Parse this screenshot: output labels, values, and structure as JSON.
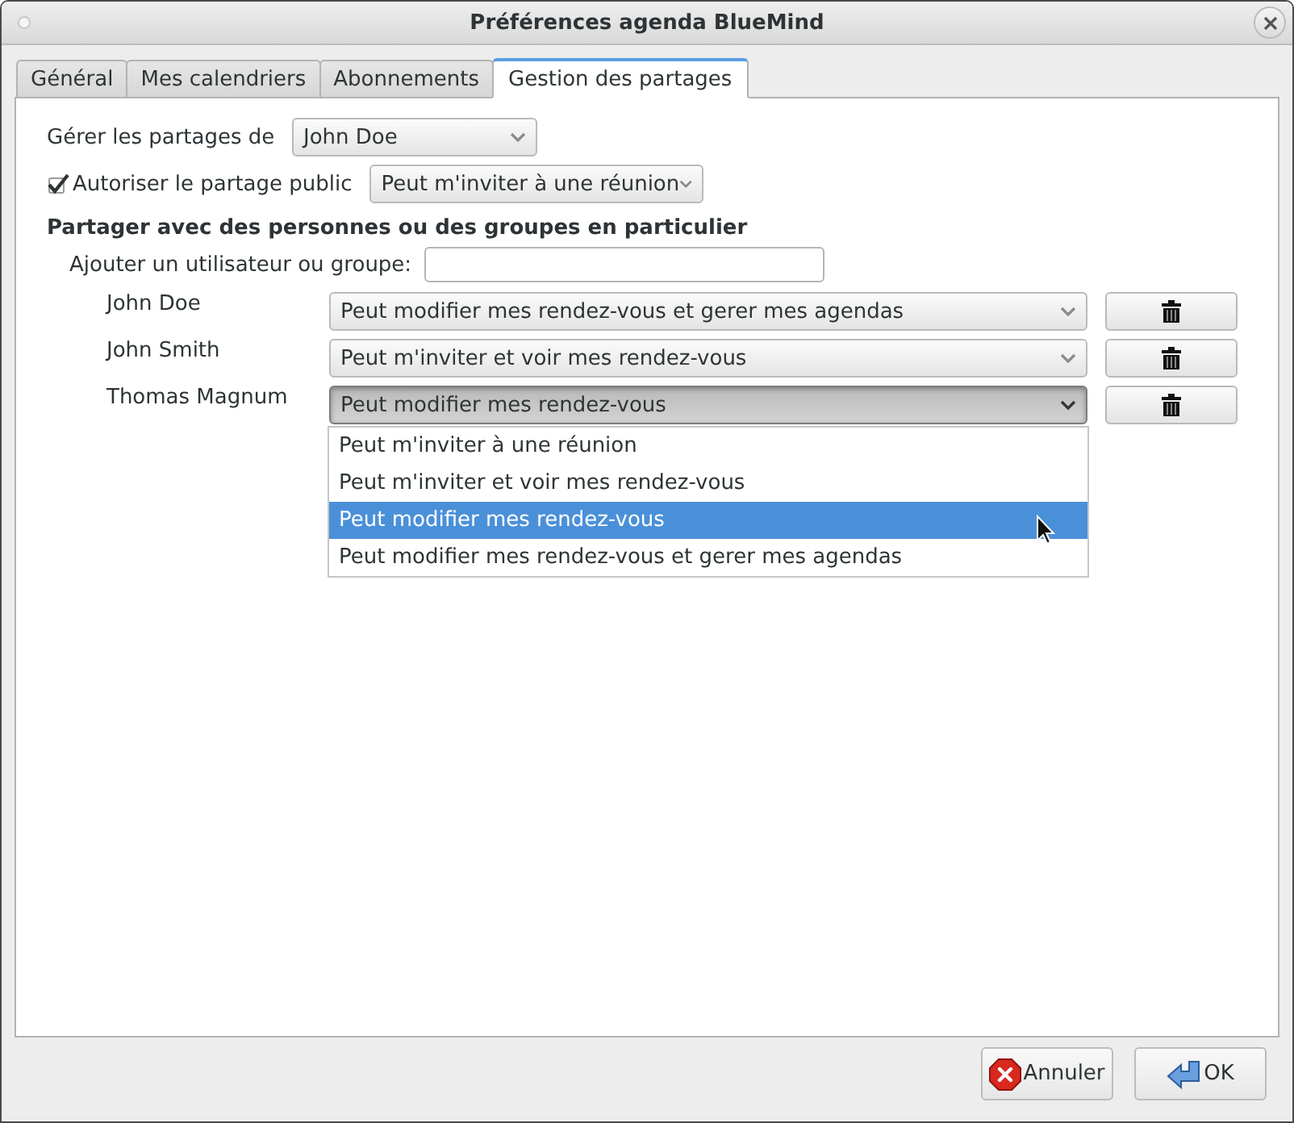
{
  "window": {
    "title": "Préférences agenda BlueMind"
  },
  "tabs": [
    {
      "label": "Général",
      "selected": false
    },
    {
      "label": "Mes calendriers",
      "selected": false
    },
    {
      "label": "Abonnements",
      "selected": false
    },
    {
      "label": "Gestion des partages",
      "selected": true
    }
  ],
  "manage_shares": {
    "label": "Gérer les partages de",
    "value": "John Doe"
  },
  "public_sharing": {
    "label": "Autoriser le partage public",
    "checked": true,
    "value": "Peut m'inviter à une réunion"
  },
  "section_title": "Partager avec des personnes ou des groupes en particulier",
  "add_user": {
    "label": "Ajouter un utilisateur ou groupe:"
  },
  "shares": [
    {
      "name": "John Doe",
      "permission": "Peut modifier mes rendez-vous et gerer mes agendas",
      "open": false
    },
    {
      "name": "John Smith",
      "permission": "Peut m'inviter et voir mes rendez-vous",
      "open": false
    },
    {
      "name": "Thomas Magnum",
      "permission": "Peut modifier mes rendez-vous",
      "open": true,
      "options": [
        {
          "label": "Peut m'inviter à une réunion",
          "selected": false
        },
        {
          "label": "Peut m'inviter et voir mes rendez-vous",
          "selected": false
        },
        {
          "label": "Peut modifier mes rendez-vous",
          "selected": true
        },
        {
          "label": "Peut modifier mes rendez-vous et gerer mes agendas",
          "selected": false
        }
      ]
    }
  ],
  "buttons": [
    {
      "label": "Annuler",
      "kind": "cancel"
    },
    {
      "label": "OK",
      "kind": "ok"
    }
  ]
}
